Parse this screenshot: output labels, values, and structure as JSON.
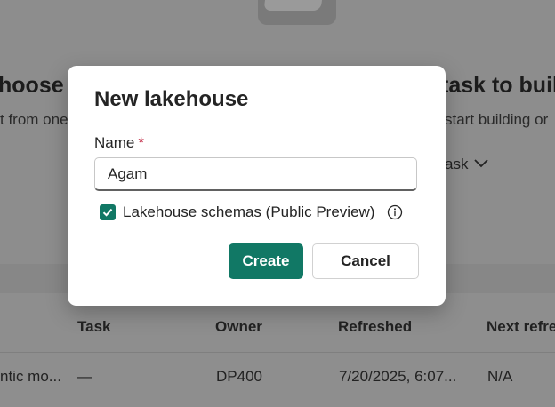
{
  "background": {
    "heading_left": "hoose f",
    "heading_right": "task to buil",
    "sub_left": "t from one",
    "sub_right": "start building or",
    "task_dropdown": "ask",
    "table_headers": [
      "Task",
      "Owner",
      "Refreshed",
      "Next refre"
    ],
    "row": {
      "name": "ntic mo...",
      "task": "—",
      "owner": "DP400",
      "refreshed": "7/20/2025, 6:07...",
      "next_refresh": "N/A"
    }
  },
  "dialog": {
    "title": "New lakehouse",
    "name_label": "Name",
    "required_mark": "*",
    "name_value": "Agam",
    "checkbox_label": "Lakehouse schemas (Public Preview)",
    "checkbox_checked": true,
    "create_label": "Create",
    "cancel_label": "Cancel"
  },
  "colors": {
    "accent": "#117865",
    "required": "#c4314b",
    "overlay": "#8b8b8b"
  },
  "icons": [
    "checkmark-icon",
    "info-icon",
    "chevron-down-icon"
  ]
}
